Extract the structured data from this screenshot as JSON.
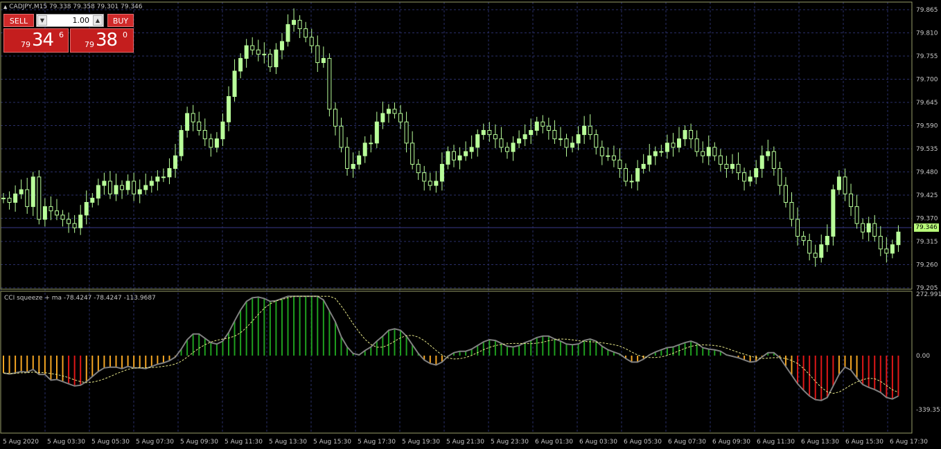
{
  "symbol_header": "CADJPY,M15  79.338 79.358 79.301 79.346",
  "trade_panel": {
    "sell_label": "SELL",
    "buy_label": "BUY",
    "lot_value": "1.00",
    "sell_price_prefix": "79",
    "sell_price_big": "34",
    "sell_price_sup": "6",
    "buy_price_prefix": "79",
    "buy_price_big": "38",
    "buy_price_sup": "0"
  },
  "price_axis": [
    "79.865",
    "79.810",
    "79.755",
    "79.700",
    "79.645",
    "79.590",
    "79.535",
    "79.480",
    "79.425",
    "79.370",
    "79.315",
    "79.260",
    "79.205"
  ],
  "current_price": "79.346",
  "indicator": {
    "title": "CCI squeeze + ma -78.4247 -78.4247 -113.9687",
    "axis_top": "272.991",
    "axis_zero": "0.00",
    "axis_bottom": "-339.351"
  },
  "time_axis": [
    "5 Aug 2020",
    "5 Aug 03:30",
    "5 Aug 05:30",
    "5 Aug 07:30",
    "5 Aug 09:30",
    "5 Aug 11:30",
    "5 Aug 13:30",
    "5 Aug 15:30",
    "5 Aug 17:30",
    "5 Aug 19:30",
    "5 Aug 21:30",
    "5 Aug 23:30",
    "6 Aug 01:30",
    "6 Aug 03:30",
    "6 Aug 05:30",
    "6 Aug 07:30",
    "6 Aug 09:30",
    "6 Aug 11:30",
    "6 Aug 13:30",
    "6 Aug 15:30",
    "6 Aug 17:30"
  ],
  "colors": {
    "grid": "#2a2f6a",
    "frame": "#9aa06a",
    "bull": "#b9ff9a",
    "bear": "#000000",
    "wick": "#b9ff9a",
    "hist_green": "#1fa01f",
    "hist_orange": "#f5a623",
    "hist_red": "#e01818",
    "cci_line": "#808080",
    "ma_line": "#e8e88a"
  },
  "chart_data": {
    "type": "candlestick",
    "ohlc_closes": [
      79.42,
      79.41,
      79.43,
      79.44,
      79.4,
      79.47,
      79.37,
      79.4,
      79.39,
      79.38,
      79.37,
      79.36,
      79.35,
      79.38,
      79.41,
      79.42,
      79.45,
      79.46,
      79.43,
      79.45,
      79.44,
      79.46,
      79.43,
      79.44,
      79.45,
      79.46,
      79.47,
      79.47,
      79.49,
      79.52,
      79.58,
      79.62,
      79.6,
      79.58,
      79.56,
      79.54,
      79.56,
      79.6,
      79.66,
      79.72,
      79.75,
      79.78,
      79.77,
      79.76,
      79.76,
      79.73,
      79.77,
      79.79,
      79.83,
      79.84,
      79.82,
      79.8,
      79.78,
      79.74,
      79.75,
      79.63,
      79.59,
      79.54,
      79.49,
      79.5,
      79.52,
      79.55,
      79.55,
      79.6,
      79.62,
      79.63,
      79.62,
      79.6,
      79.55,
      79.5,
      79.48,
      79.46,
      79.45,
      79.46,
      79.5,
      79.53,
      79.51,
      79.52,
      79.53,
      79.54,
      79.57,
      79.58,
      79.57,
      79.56,
      79.54,
      79.53,
      79.55,
      79.56,
      79.57,
      79.58,
      79.6,
      79.59,
      79.58,
      79.56,
      79.56,
      79.54,
      79.55,
      79.57,
      79.59,
      79.57,
      79.54,
      79.52,
      79.52,
      79.51,
      79.49,
      79.46,
      79.46,
      79.49,
      79.5,
      79.52,
      79.53,
      79.53,
      79.55,
      79.54,
      79.56,
      79.58,
      79.56,
      79.53,
      79.52,
      79.54,
      79.52,
      79.5,
      79.49,
      79.5,
      79.48,
      79.46,
      79.47,
      79.49,
      79.52,
      79.53,
      79.49,
      79.45,
      79.41,
      79.37,
      79.33,
      79.32,
      79.29,
      79.28,
      79.31,
      79.33,
      79.44,
      79.47,
      79.43,
      79.4,
      79.36,
      79.34,
      79.36,
      79.33,
      79.3,
      79.29,
      79.31,
      79.34
    ],
    "ylim": [
      79.205,
      79.865
    ]
  }
}
